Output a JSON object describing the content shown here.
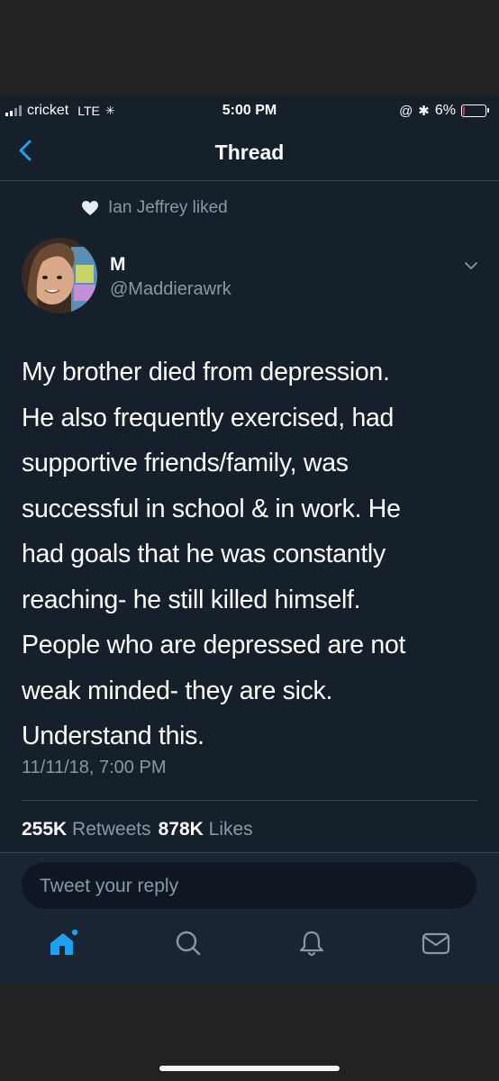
{
  "status_bar": {
    "carrier": "cricket",
    "network": "LTE",
    "time": "5:00 PM",
    "battery": "6%",
    "battery_level": 0.06,
    "battery_color": "#e0245e"
  },
  "header": {
    "title": "Thread",
    "back_icon": "chevron-left-icon"
  },
  "social_context": {
    "text": "Ian Jeffrey liked",
    "icon": "heart-icon"
  },
  "tweet": {
    "author_name": "M",
    "author_handle": "@Maddierawrk",
    "lines": [
      "My brother died from depression.",
      "He also frequently exercised, had",
      "supportive friends/family, was",
      "successful in school & in work. He",
      "had goals that he was constantly",
      "reaching- he still killed himself.",
      "People who are depressed are not",
      "weak minded- they are sick.",
      "Understand this."
    ],
    "timestamp": "11/11/18, 7:00 PM",
    "retweets_count": "255K",
    "retweets_label": "Retweets",
    "likes_count": "878K",
    "likes_label": "Likes"
  },
  "reply": {
    "placeholder": "Tweet your reply"
  },
  "tab_bar": {
    "items": [
      "home-icon",
      "search-icon",
      "notifications-icon",
      "messages-icon"
    ],
    "accent": "#1da1f2",
    "inactive": "#8899a6"
  }
}
